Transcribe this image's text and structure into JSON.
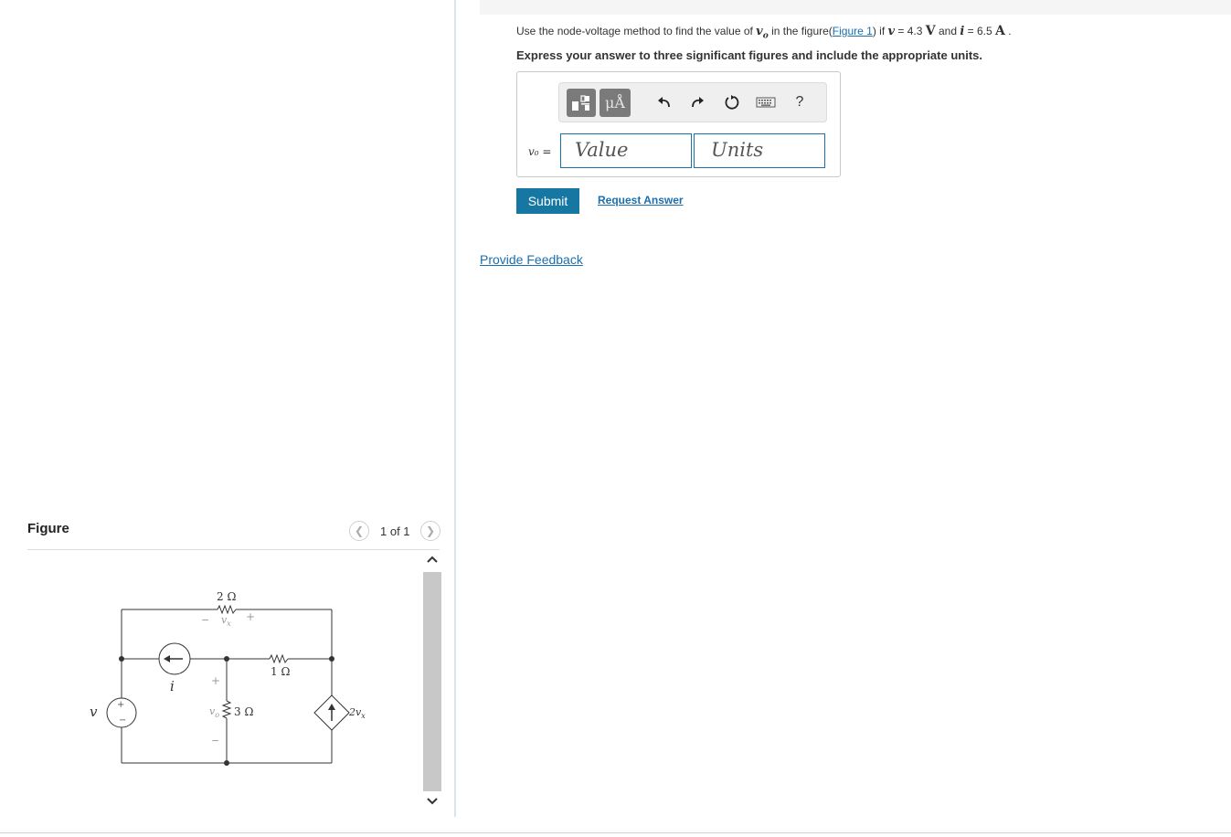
{
  "question": {
    "prefix": "Use the node-voltage method to find the value of ",
    "vo": "v",
    "vo_sub": "o",
    "middle": " in the figure(",
    "figure_link": "Figure 1",
    "close": ") if ",
    "v_var": "v",
    "v_eq": " = 4.3 ",
    "v_unit": "V",
    "and": " and ",
    "i_var": "i",
    "i_eq": " = 6.5 ",
    "i_unit": "A",
    "end": " ."
  },
  "instruction": "Express your answer to three significant figures and include the appropriate units.",
  "answer": {
    "label": "v₀ =",
    "value_placeholder": "Value",
    "units_placeholder": "Units",
    "toolbar": {
      "units_button": "μÅ",
      "help": "?",
      "icons": [
        "templates-icon",
        "units-icon",
        "undo-icon",
        "redo-icon",
        "reset-icon",
        "keyboard-icon",
        "help-icon"
      ]
    }
  },
  "actions": {
    "submit": "Submit",
    "request_answer": "Request Answer",
    "provide_feedback": "Provide Feedback"
  },
  "figure": {
    "title": "Figure",
    "pager": "1 of 1",
    "circuit_labels": {
      "r_top": "2 Ω",
      "vx_minus": "−",
      "vx": "v",
      "vx_sub": "x",
      "vx_plus": "+",
      "r_mid": "1 Ω",
      "r_vert": "3 Ω",
      "i": "i",
      "v": "v",
      "vo_plus": "+",
      "vo": "v",
      "vo_sub": "o",
      "vo_minus": "−",
      "src_plus": "+",
      "src_minus": "−",
      "dep": "2v",
      "dep_sub": "x"
    }
  },
  "colors": {
    "link": "#1a6faf",
    "submit_bg": "#1677a2",
    "field_border": "#1a73a8"
  }
}
